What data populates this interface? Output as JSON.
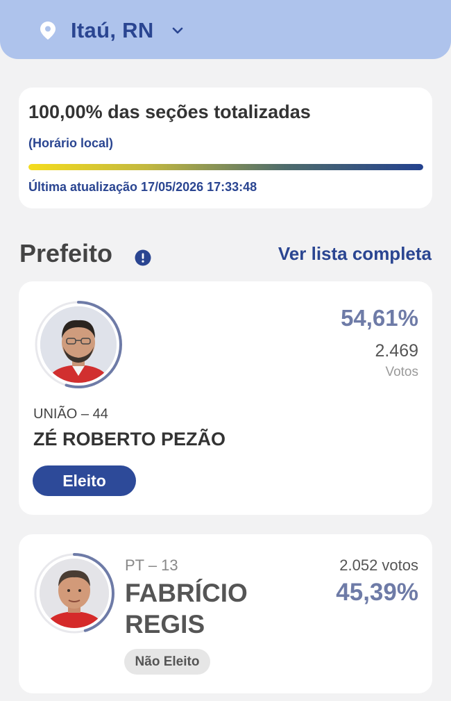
{
  "location": {
    "name": "Itaú, RN",
    "pin_icon": "location-pin-icon",
    "dropdown_icon": "chevron-down-icon"
  },
  "status": {
    "title": "100,00% das seções totalizadas",
    "subtitle": "(Horário local)",
    "progress": 1.0,
    "last_update": "Última atualização 17/05/2026 17:33:48"
  },
  "section": {
    "title": "Prefeito",
    "info_icon": "info-icon",
    "see_all": "Ver lista completa"
  },
  "candidates": [
    {
      "party": "UNIÃO – 44",
      "name": "ZÉ ROBERTO PEZÃO",
      "percent": "54,61%",
      "percent_value": 54.61,
      "votes": "2.469",
      "votes_label": "Votos",
      "status": "Eleito"
    },
    {
      "party": "PT – 13",
      "name_line1": "FABRÍCIO",
      "name_line2": "REGIS",
      "percent": "45,39%",
      "percent_value": 45.39,
      "votes": "2.052 votos",
      "status": "Não Eleito"
    }
  ],
  "colors": {
    "primary": "#2a4591",
    "header_bg": "#aec3ec",
    "percent": "#6e7ba7",
    "ring": "#6e7ba7"
  }
}
